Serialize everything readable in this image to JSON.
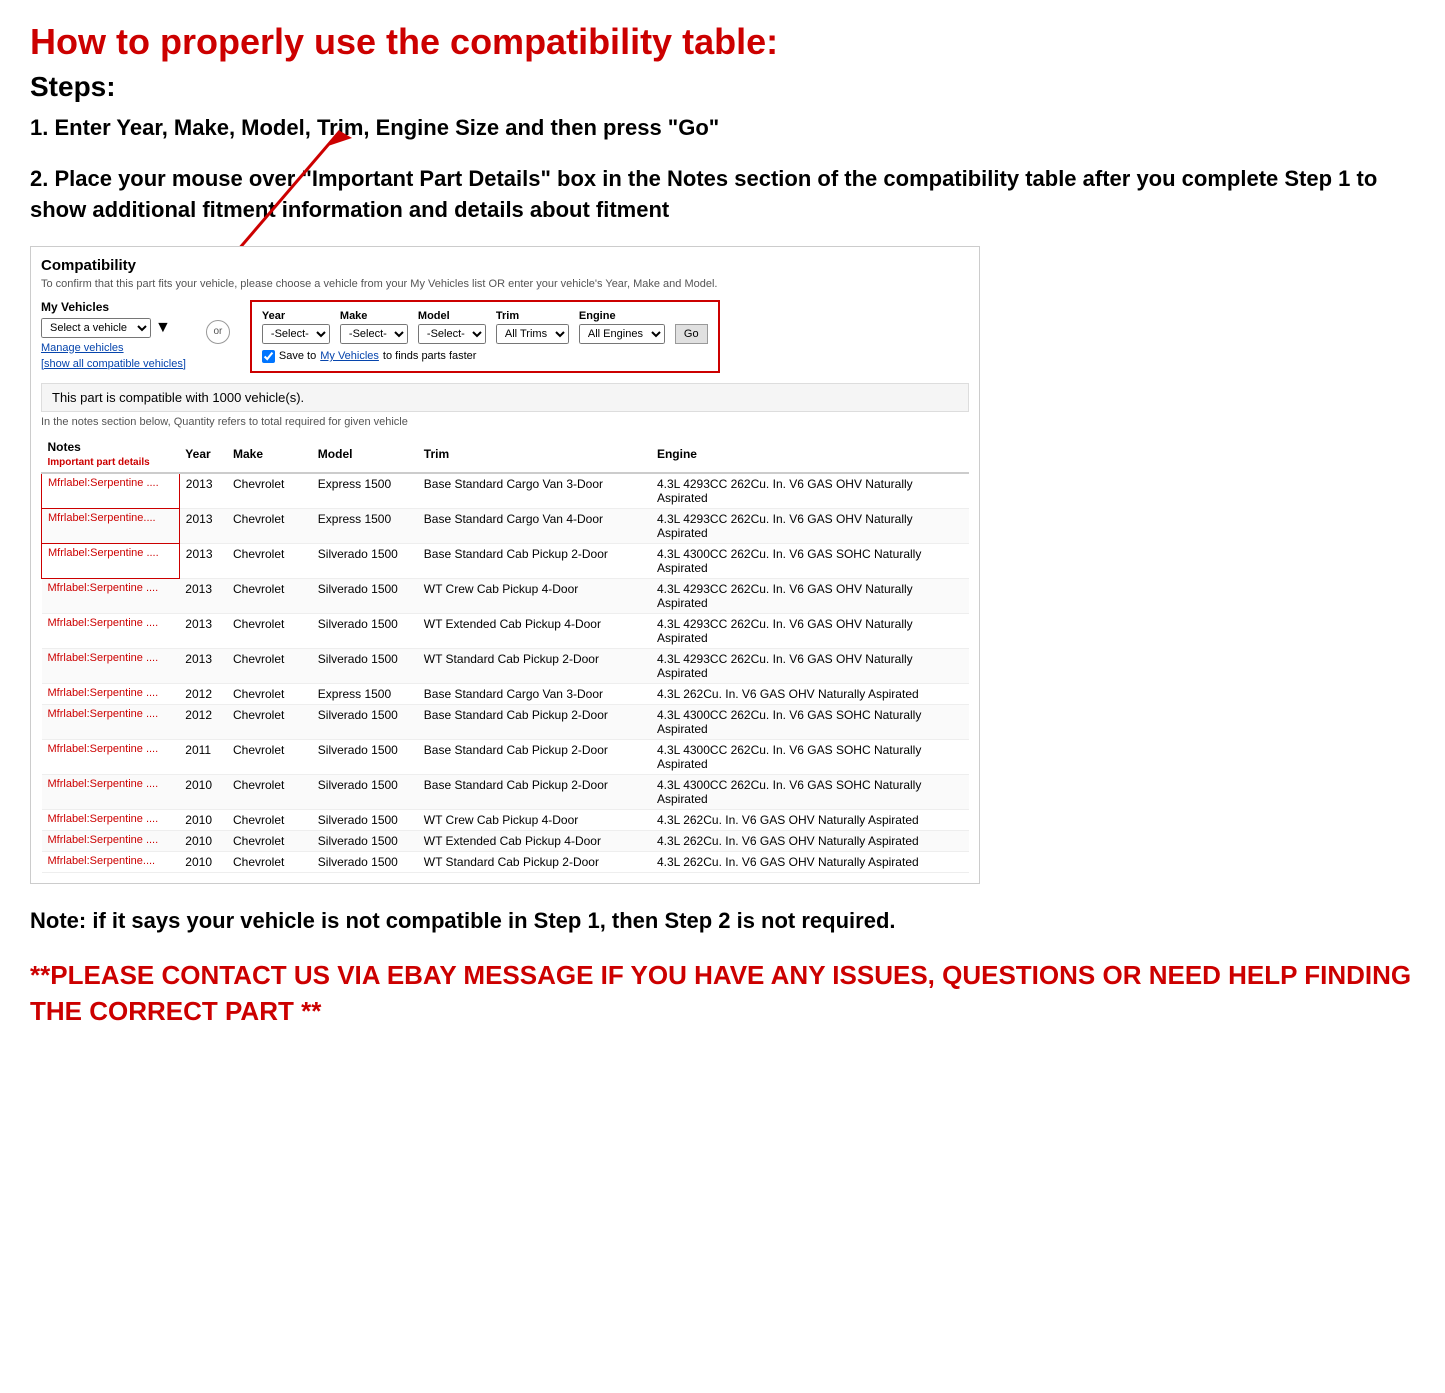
{
  "page": {
    "main_title": "How to properly use the compatibility table:",
    "steps_heading": "Steps:",
    "step1": "1. Enter Year, Make, Model, Trim, Engine Size and then press \"Go\"",
    "step2": "2. Place your mouse over \"Important Part Details\" box in the Notes section of the compatibility table after you complete Step 1 to show additional fitment information and details about fitment",
    "note": "Note: if it says your vehicle is not compatible in Step 1, then Step 2 is not required.",
    "contact": "**PLEASE CONTACT US VIA EBAY MESSAGE IF YOU HAVE ANY ISSUES, QUESTIONS OR NEED HELP FINDING THE CORRECT PART **"
  },
  "compatibility": {
    "title": "Compatibility",
    "subtitle": "To confirm that this part fits your vehicle, please choose a vehicle from your My Vehicles list OR enter your vehicle's Year, Make and Model.",
    "my_vehicles_label": "My Vehicles",
    "select_vehicle_placeholder": "Select a vehicle",
    "manage_vehicles": "Manage vehicles",
    "show_all": "[show all compatible vehicles]",
    "or_label": "or",
    "year_label": "Year",
    "year_value": "-Select-",
    "make_label": "Make",
    "make_value": "-Select-",
    "model_label": "Model",
    "model_value": "-Select-",
    "trim_label": "Trim",
    "trim_value": "All Trims",
    "engine_label": "Engine",
    "engine_value": "All Engines",
    "go_button": "Go",
    "save_text": "Save to ",
    "save_link": "My Vehicles",
    "save_suffix": " to finds parts faster",
    "compatible_count": "This part is compatible with 1000 vehicle(s).",
    "quantity_note": "In the notes section below, Quantity refers to total required for given vehicle",
    "table_headers": {
      "notes": "Notes",
      "notes_sub": "Important part details",
      "year": "Year",
      "make": "Make",
      "model": "Model",
      "trim": "Trim",
      "engine": "Engine"
    },
    "rows": [
      {
        "notes": "Mfrlabel:Serpentine ....",
        "year": "2013",
        "make": "Chevrolet",
        "model": "Express 1500",
        "trim": "Base Standard Cargo Van 3-Door",
        "engine": "4.3L 4293CC 262Cu. In. V6 GAS OHV Naturally Aspirated"
      },
      {
        "notes": "Mfrlabel:Serpentine....",
        "year": "2013",
        "make": "Chevrolet",
        "model": "Express 1500",
        "trim": "Base Standard Cargo Van 4-Door",
        "engine": "4.3L 4293CC 262Cu. In. V6 GAS OHV Naturally Aspirated"
      },
      {
        "notes": "Mfrlabel:Serpentine ....",
        "year": "2013",
        "make": "Chevrolet",
        "model": "Silverado 1500",
        "trim": "Base Standard Cab Pickup 2-Door",
        "engine": "4.3L 4300CC 262Cu. In. V6 GAS SOHC Naturally Aspirated"
      },
      {
        "notes": "Mfrlabel:Serpentine ....",
        "year": "2013",
        "make": "Chevrolet",
        "model": "Silverado 1500",
        "trim": "WT Crew Cab Pickup 4-Door",
        "engine": "4.3L 4293CC 262Cu. In. V6 GAS OHV Naturally Aspirated"
      },
      {
        "notes": "Mfrlabel:Serpentine ....",
        "year": "2013",
        "make": "Chevrolet",
        "model": "Silverado 1500",
        "trim": "WT Extended Cab Pickup 4-Door",
        "engine": "4.3L 4293CC 262Cu. In. V6 GAS OHV Naturally Aspirated"
      },
      {
        "notes": "Mfrlabel:Serpentine ....",
        "year": "2013",
        "make": "Chevrolet",
        "model": "Silverado 1500",
        "trim": "WT Standard Cab Pickup 2-Door",
        "engine": "4.3L 4293CC 262Cu. In. V6 GAS OHV Naturally Aspirated"
      },
      {
        "notes": "Mfrlabel:Serpentine ....",
        "year": "2012",
        "make": "Chevrolet",
        "model": "Express 1500",
        "trim": "Base Standard Cargo Van 3-Door",
        "engine": "4.3L 262Cu. In. V6 GAS OHV Naturally Aspirated"
      },
      {
        "notes": "Mfrlabel:Serpentine ....",
        "year": "2012",
        "make": "Chevrolet",
        "model": "Silverado 1500",
        "trim": "Base Standard Cab Pickup 2-Door",
        "engine": "4.3L 4300CC 262Cu. In. V6 GAS SOHC Naturally Aspirated"
      },
      {
        "notes": "Mfrlabel:Serpentine ....",
        "year": "2011",
        "make": "Chevrolet",
        "model": "Silverado 1500",
        "trim": "Base Standard Cab Pickup 2-Door",
        "engine": "4.3L 4300CC 262Cu. In. V6 GAS SOHC Naturally Aspirated"
      },
      {
        "notes": "Mfrlabel:Serpentine ....",
        "year": "2010",
        "make": "Chevrolet",
        "model": "Silverado 1500",
        "trim": "Base Standard Cab Pickup 2-Door",
        "engine": "4.3L 4300CC 262Cu. In. V6 GAS SOHC Naturally Aspirated"
      },
      {
        "notes": "Mfrlabel:Serpentine ....",
        "year": "2010",
        "make": "Chevrolet",
        "model": "Silverado 1500",
        "trim": "WT Crew Cab Pickup 4-Door",
        "engine": "4.3L 262Cu. In. V6 GAS OHV Naturally Aspirated"
      },
      {
        "notes": "Mfrlabel:Serpentine ....",
        "year": "2010",
        "make": "Chevrolet",
        "model": "Silverado 1500",
        "trim": "WT Extended Cab Pickup 4-Door",
        "engine": "4.3L 262Cu. In. V6 GAS OHV Naturally Aspirated"
      },
      {
        "notes": "Mfrlabel:Serpentine....",
        "year": "2010",
        "make": "Chevrolet",
        "model": "Silverado 1500",
        "trim": "WT Standard Cab Pickup 2-Door",
        "engine": "4.3L 262Cu. In. V6 GAS OHV Naturally Aspirated"
      }
    ]
  }
}
